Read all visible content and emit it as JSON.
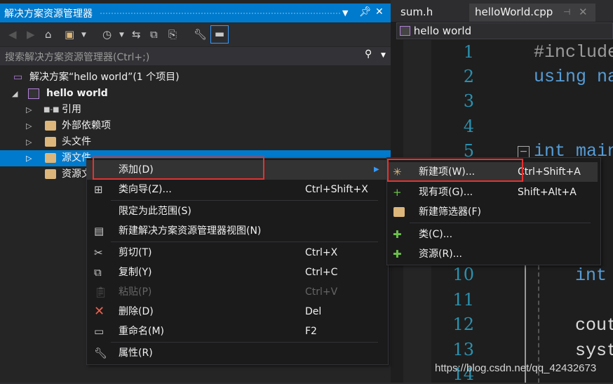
{
  "explorer": {
    "title": "解决方案资源管理器",
    "search_placeholder": "搜索解决方案资源管理器(Ctrl+;)",
    "solution": "解决方案“hello world”(1 个项目)",
    "project": "hello world",
    "nodes": [
      "引用",
      "外部依赖项",
      "头文件",
      "源文件",
      "资源文件"
    ]
  },
  "editor": {
    "tabs": [
      "sum.h",
      "helloWorld.cpp"
    ],
    "breadcrumb": "hello world",
    "line_numbers": [
      "1",
      "2",
      "3",
      "4",
      "5",
      "10",
      "11",
      "12",
      "13",
      "14"
    ],
    "code": {
      "l1": "#include",
      "l2": "using na",
      "l5": "int main",
      "l10": "int",
      "l12": "cout",
      "l13": "syst"
    }
  },
  "context_menu": {
    "items": [
      {
        "label": "添加(D)",
        "shortcut": ""
      },
      {
        "label": "类向导(Z)...",
        "shortcut": "Ctrl+Shift+X"
      },
      {
        "label": "限定为此范围(S)",
        "shortcut": ""
      },
      {
        "label": "新建解决方案资源管理器视图(N)",
        "shortcut": ""
      },
      {
        "label": "剪切(T)",
        "shortcut": "Ctrl+X"
      },
      {
        "label": "复制(Y)",
        "shortcut": "Ctrl+C"
      },
      {
        "label": "粘贴(P)",
        "shortcut": "Ctrl+V",
        "disabled": true
      },
      {
        "label": "删除(D)",
        "shortcut": "Del"
      },
      {
        "label": "重命名(M)",
        "shortcut": "F2"
      },
      {
        "label": "属性(R)",
        "shortcut": ""
      }
    ]
  },
  "submenu": {
    "items": [
      {
        "label": "新建项(W)...",
        "shortcut": "Ctrl+Shift+A"
      },
      {
        "label": "现有项(G)...",
        "shortcut": "Shift+Alt+A"
      },
      {
        "label": "新建筛选器(F)",
        "shortcut": ""
      },
      {
        "label": "类(C)...",
        "shortcut": ""
      },
      {
        "label": "资源(R)...",
        "shortcut": ""
      }
    ]
  },
  "watermark": "https://blog.csdn.net/qq_42432673",
  "colors": {
    "accent": "#007acc",
    "highlight_box": "#e8312f"
  }
}
